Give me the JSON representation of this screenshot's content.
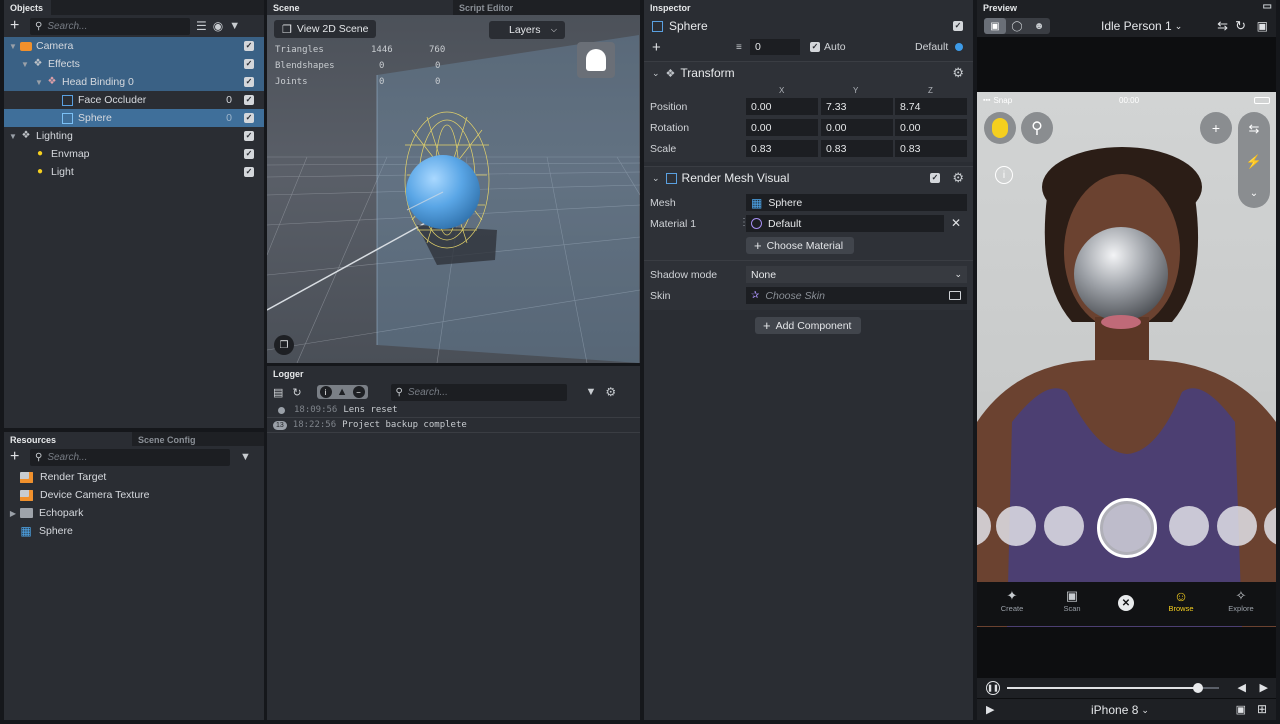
{
  "objects": {
    "title": "Objects",
    "search_placeholder": "Search...",
    "tree": [
      {
        "label": "Camera",
        "value": ""
      },
      {
        "label": "Effects",
        "value": ""
      },
      {
        "label": "Head Binding 0",
        "value": ""
      },
      {
        "label": "Face Occluder",
        "value": "0"
      },
      {
        "label": "Sphere",
        "value": "0"
      },
      {
        "label": "Lighting",
        "value": ""
      },
      {
        "label": "Envmap",
        "value": ""
      },
      {
        "label": "Light",
        "value": ""
      }
    ]
  },
  "resources": {
    "tab_active": "Resources",
    "tab_inactive": "Scene Config",
    "search_placeholder": "Search...",
    "items": [
      "Render Target",
      "Device Camera Texture",
      "Echopark",
      "Sphere"
    ]
  },
  "scene": {
    "tab_active": "Scene",
    "tab_inactive": "Script Editor",
    "view2d": "View 2D Scene",
    "layers": "Layers",
    "stats": [
      {
        "label": "Triangles",
        "a": "1446",
        "b": "760"
      },
      {
        "label": "Blendshapes",
        "a": "0",
        "b": "0"
      },
      {
        "label": "Joints",
        "a": "0",
        "b": "0"
      }
    ]
  },
  "logger": {
    "title": "Logger",
    "search_placeholder": "Search...",
    "entries": [
      {
        "badge": "",
        "time": "18:09:56",
        "msg": "Lens reset"
      },
      {
        "badge": "13",
        "time": "18:22:56",
        "msg": "Project backup complete"
      }
    ]
  },
  "inspector": {
    "title": "Inspector",
    "object_name": "Sphere",
    "layer_value": "0",
    "auto_label": "Auto",
    "default_label": "Default",
    "transform": {
      "title": "Transform",
      "col_x": "X",
      "col_y": "Y",
      "col_z": "Z",
      "rows": [
        {
          "label": "Position",
          "x": "0.00",
          "y": "7.33",
          "z": "8.74"
        },
        {
          "label": "Rotation",
          "x": "0.00",
          "y": "0.00",
          "z": "0.00"
        },
        {
          "label": "Scale",
          "x": "0.83",
          "y": "0.83",
          "z": "0.83"
        }
      ]
    },
    "rmv": {
      "title": "Render Mesh Visual",
      "mesh_label": "Mesh",
      "mesh_value": "Sphere",
      "material_label": "Material 1",
      "material_value": "Default",
      "choose_material": "Choose Material",
      "shadow_label": "Shadow mode",
      "shadow_value": "None",
      "skin_label": "Skin",
      "skin_placeholder": "Choose Skin"
    },
    "add_component": "Add Component"
  },
  "preview": {
    "title": "Preview",
    "person": "Idle Person 1",
    "status_left": "Snap",
    "status_time": "00:00",
    "nav": [
      "Create",
      "Scan",
      "",
      "Browse",
      "Explore"
    ],
    "device": "iPhone 8",
    "playback_progress": 0.9,
    "accent": "#f5cf1f"
  }
}
